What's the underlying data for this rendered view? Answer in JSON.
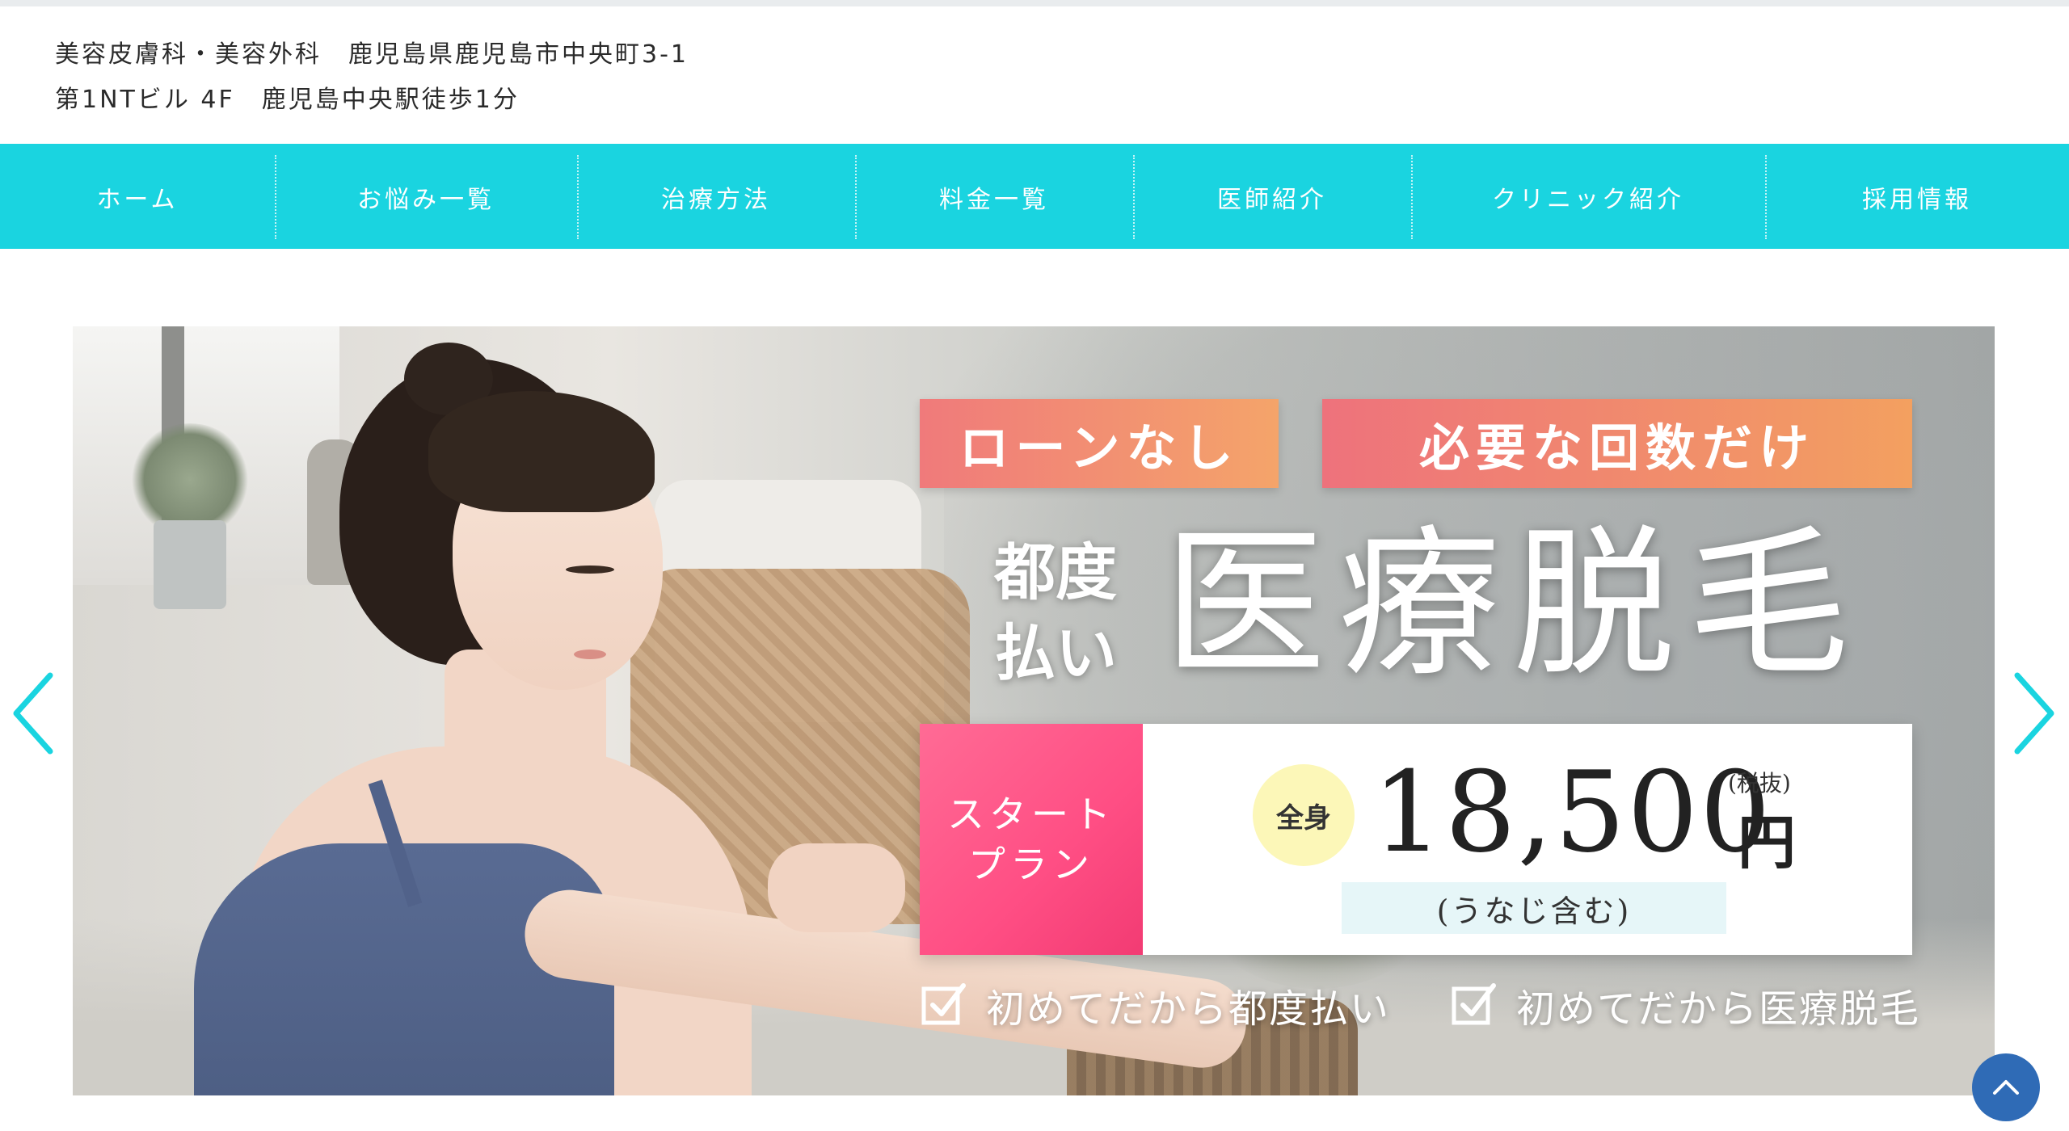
{
  "header": {
    "line1": "美容皮膚科・美容外科　鹿児島県鹿児島市中央町3-1",
    "line2": "第1NTビル 4F　鹿児島中央駅徒歩1分"
  },
  "nav": {
    "items": [
      {
        "label": "ホーム"
      },
      {
        "label": "お悩み一覧"
      },
      {
        "label": "治療方法"
      },
      {
        "label": "料金一覧"
      },
      {
        "label": "医師紹介"
      },
      {
        "label": "クリニック紹介"
      },
      {
        "label": "採用情報"
      }
    ],
    "color": "#1ad4e0"
  },
  "banner": {
    "tag1": "ローンなし",
    "tag2": "必要な回数だけ",
    "subtitle": "都度\n払い",
    "headline": "医療脱毛",
    "plan": "スタート\nプラン",
    "badge": "全身",
    "amount": "18,500",
    "tax": "(税抜)",
    "yen": "円",
    "note": "(うなじ含む)",
    "check1": "初めてだから都度払い",
    "check2": "初めてだから医療脱毛",
    "accent_pink": "#ff4e84",
    "accent_orange": "#f3a060"
  },
  "carousel": {
    "prev_icon": "chevron-left-icon",
    "next_icon": "chevron-right-icon",
    "arrow_color": "#1ad4e0"
  },
  "scroll_top": {
    "icon": "chevron-up-icon",
    "color": "#2f6bb6"
  }
}
